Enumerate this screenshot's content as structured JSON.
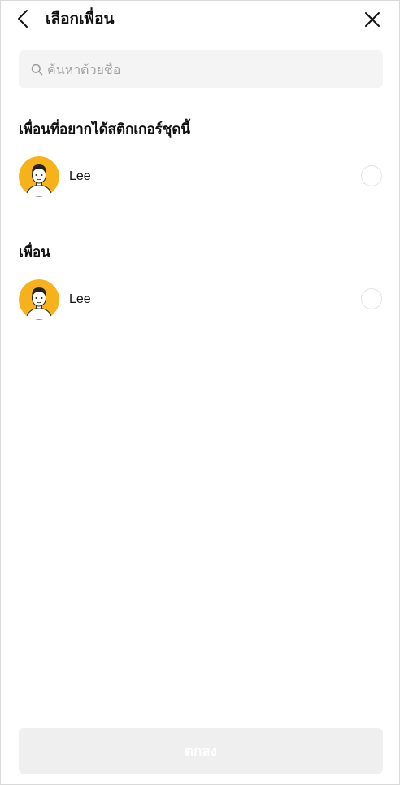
{
  "header": {
    "title": "เลือกเพื่อน",
    "back_icon": "chevron-left-icon",
    "close_icon": "close-icon"
  },
  "search": {
    "placeholder": "ค้นหาด้วยชื่อ",
    "value": "",
    "icon": "search-icon"
  },
  "sections": [
    {
      "title": "เพื่อนที่อยากได้สติกเกอร์ชุดนี้",
      "friends": [
        {
          "name": "Lee",
          "avatar_bg": "#F7B21B",
          "selected": false
        }
      ]
    },
    {
      "title": "เพื่อน",
      "friends": [
        {
          "name": "Lee",
          "avatar_bg": "#F7B21B",
          "selected": false
        }
      ]
    }
  ],
  "footer": {
    "confirm_label": "ตกลง",
    "confirm_enabled": false
  },
  "colors": {
    "avatar_bg": "#F7B21B",
    "search_bg": "#F4F4F4",
    "button_disabled_bg": "#EFEFEF"
  }
}
